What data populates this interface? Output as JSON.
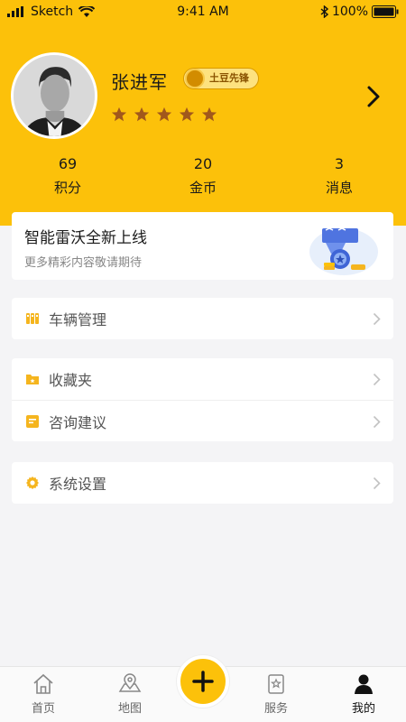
{
  "status_bar": {
    "carrier": "Sketch",
    "time": "9:41 AM",
    "battery": "100%"
  },
  "profile": {
    "name": "张进军",
    "badge": "土豆先锋",
    "stars": 5
  },
  "stats": [
    {
      "value": "69",
      "label": "积分"
    },
    {
      "value": "20",
      "label": "金币"
    },
    {
      "value": "3",
      "label": "消息"
    }
  ],
  "promo": {
    "title": "智能雷沃全新上线",
    "subtitle": "更多精彩内容敬请期待"
  },
  "menu": {
    "vehicle": "车辆管理",
    "favorites": "收藏夹",
    "consult": "咨询建议",
    "settings": "系统设置"
  },
  "tabs": [
    {
      "label": "首页",
      "icon": "home-icon"
    },
    {
      "label": "地图",
      "icon": "map-icon"
    },
    {
      "label": "服务",
      "icon": "service-icon"
    },
    {
      "label": "我的",
      "icon": "profile-icon"
    }
  ],
  "colors": {
    "accent": "#fcc10a",
    "star": "#a1581c",
    "icon": "#f5b51e"
  }
}
